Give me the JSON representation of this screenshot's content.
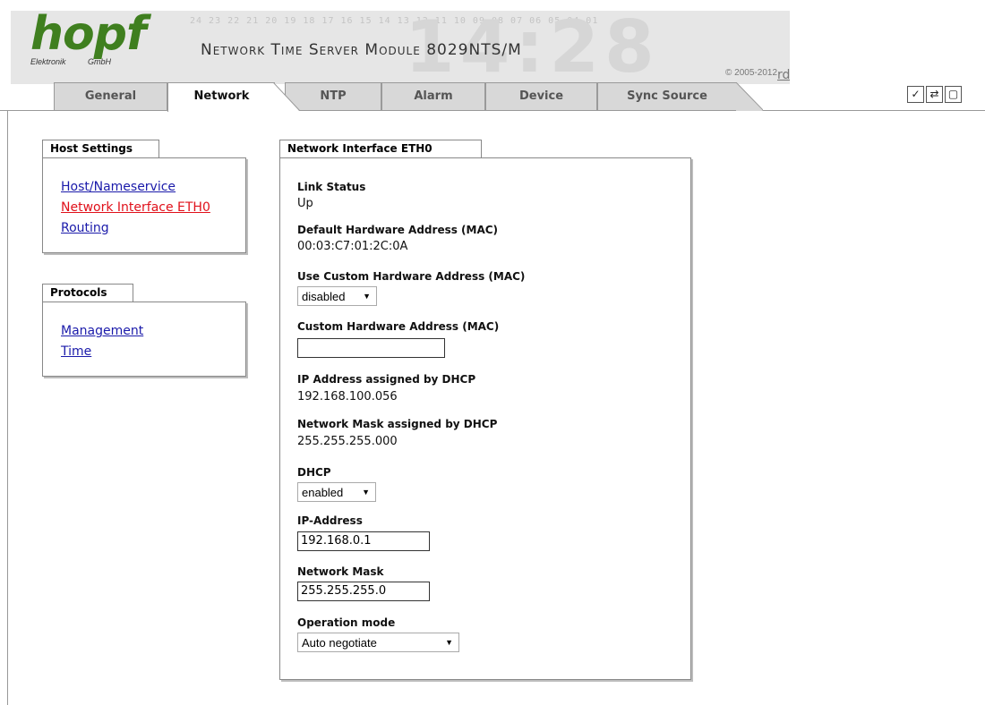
{
  "header": {
    "logo_word": "hopf",
    "logo_sub_left": "Elektronik",
    "logo_sub_right": "GmbH",
    "title": "Network Time Server Module 8029NTS/M",
    "background_numbers": "24 23 22 21 20 19 18 17 16 15 14 13 12 11 10 09 08 07 06 05 04 01",
    "copyright_prefix": "© 2005-2012",
    "copyright_link": "rdcs.eu"
  },
  "tabs": [
    {
      "label": "General"
    },
    {
      "label": "Network"
    },
    {
      "label": "NTP"
    },
    {
      "label": "Alarm"
    },
    {
      "label": "Device"
    },
    {
      "label": "Sync Source"
    }
  ],
  "active_tab": "Network",
  "toolbar": {
    "apply_icon": "check-icon",
    "reload_icon": "refresh-icon",
    "save_icon": "save-icon"
  },
  "sidebar": {
    "host_settings": {
      "title": "Host Settings",
      "items": [
        "Host/Nameservice",
        "Network Interface ETH0",
        "Routing"
      ]
    },
    "protocols": {
      "title": "Protocols",
      "items": [
        "Management",
        "Time"
      ]
    }
  },
  "form": {
    "title": "Network Interface ETH0",
    "link_status_label": "Link Status",
    "link_status_value": "Up",
    "default_mac_label": "Default Hardware Address (MAC)",
    "default_mac_value": "00:03:C7:01:2C:0A",
    "use_custom_mac_label": "Use Custom Hardware Address (MAC)",
    "use_custom_mac_value": "disabled",
    "custom_mac_label": "Custom Hardware Address (MAC)",
    "custom_mac_value": "",
    "dhcp_ip_label": "IP Address assigned by DHCP",
    "dhcp_ip_value": "192.168.100.056",
    "dhcp_mask_label": "Network Mask assigned by DHCP",
    "dhcp_mask_value": "255.255.255.000",
    "dhcp_label": "DHCP",
    "dhcp_value": "enabled",
    "ip_label": "IP-Address",
    "ip_value": "192.168.0.1",
    "mask_label": "Network Mask",
    "mask_value": "255.255.255.0",
    "opmode_label": "Operation mode",
    "opmode_value": "Auto negotiate"
  },
  "colors": {
    "logo_green": "#3f7f1f",
    "link_blue": "#1a1aaa",
    "link_active_red": "#e0101a"
  }
}
